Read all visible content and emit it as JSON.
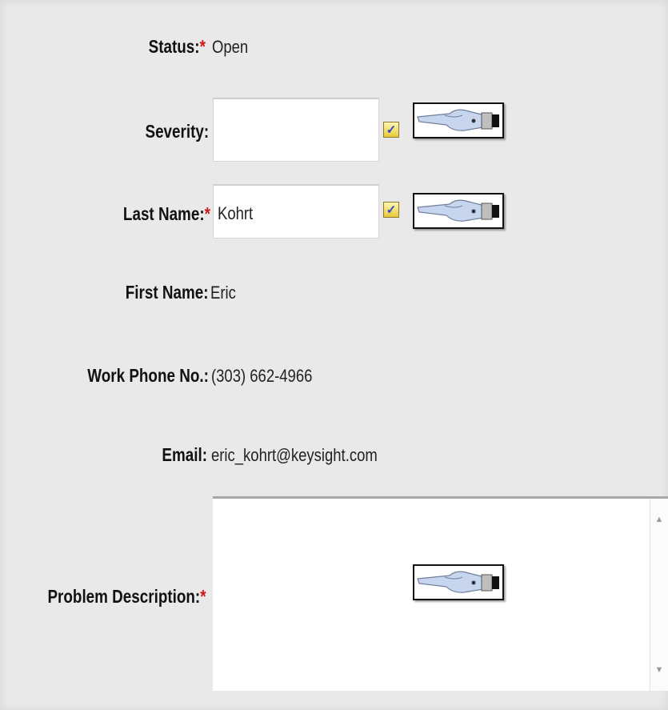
{
  "form": {
    "status": {
      "label": "Status:",
      "required_mark": "*",
      "value": "Open"
    },
    "severity": {
      "label": "Severity:",
      "value": ""
    },
    "last_name": {
      "label": "Last Name:",
      "required_mark": "*",
      "value": "Kohrt"
    },
    "first_name": {
      "label": "First Name:",
      "value": "Eric"
    },
    "work_phone": {
      "label": "Work Phone No.:",
      "value": "(303) 662-4966"
    },
    "email": {
      "label": "Email:",
      "value": "eric_kohrt@keysight.com"
    },
    "problem_description": {
      "label": "Problem Description:",
      "required_mark": "*",
      "value": ""
    }
  },
  "icons": {
    "lookup": "lookup-check-icon",
    "pointer": "pointing-hand-icon",
    "scroll_up": "scroll-up-arrow-icon",
    "scroll_down": "scroll-down-arrow-icon"
  },
  "colors": {
    "background": "#e9e9e9",
    "required": "#d01818",
    "lookup_fill": "#e9c93a",
    "lookup_check": "#2a46c8"
  }
}
